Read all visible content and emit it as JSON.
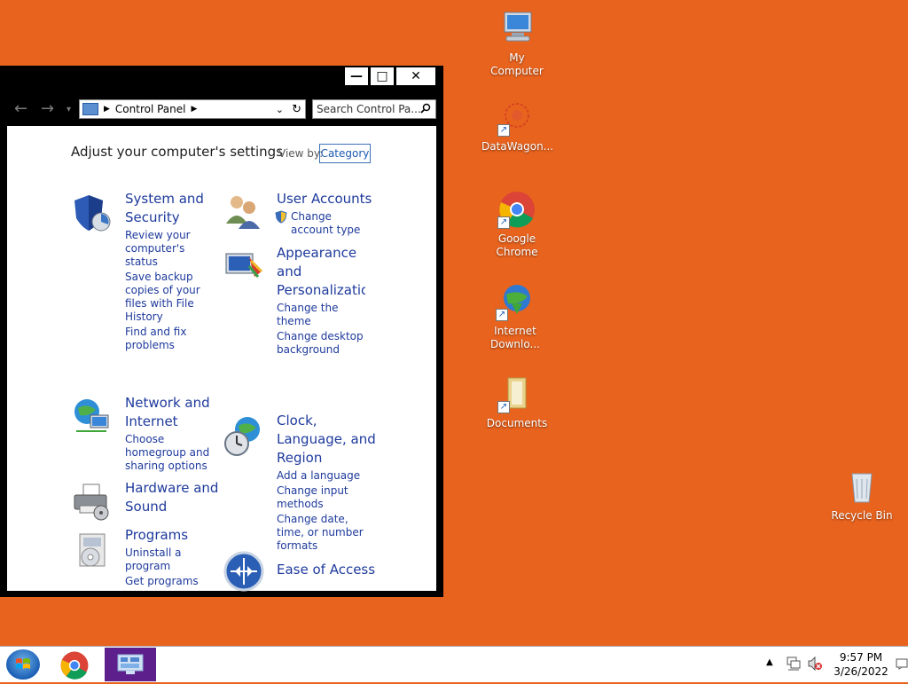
{
  "desktop_icons": [
    {
      "label": "My Computer"
    },
    {
      "label": "DataWagon..."
    },
    {
      "label": "Google Chrome"
    },
    {
      "label": "Internet Downlo..."
    },
    {
      "label": "Documents"
    },
    {
      "label": "Recycle Bin"
    }
  ],
  "window": {
    "title_buttons": {
      "minimize": "—",
      "maximize": "□",
      "close": "✕"
    },
    "address": "Control Panel",
    "search_placeholder": "Search Control Pa...",
    "heading": "Adjust your computer's settings",
    "view_by_label": "View by:",
    "view_by_value": "Category",
    "categories": [
      {
        "title": "System and Security",
        "links": [
          "Review your computer's status",
          "Save backup copies of your files with File History",
          "Find and fix problems"
        ]
      },
      {
        "title": "Network and Internet",
        "links": [
          "Choose homegroup and sharing options"
        ]
      },
      {
        "title": "Hardware and Sound",
        "links": []
      },
      {
        "title": "Programs",
        "links": [
          "Uninstall a program",
          "Get programs"
        ]
      },
      {
        "title": "User Accounts",
        "links": [
          "Change account type"
        ]
      },
      {
        "title": "Appearance and Personalization",
        "links": [
          "Change the theme",
          "Change desktop background"
        ]
      },
      {
        "title": "Clock, Language, and Region",
        "links": [
          "Add a language",
          "Change input methods",
          "Change date, time, or number formats"
        ]
      },
      {
        "title": "Ease of Access",
        "links": []
      }
    ]
  },
  "taskbar": {
    "time": "9:57 PM",
    "date": "3/26/2022",
    "tray_arrow": "▲"
  },
  "colors": {
    "desktop": "#e8631e",
    "link": "#1e3a9c",
    "taskbar_active": "#5c1f8c"
  }
}
